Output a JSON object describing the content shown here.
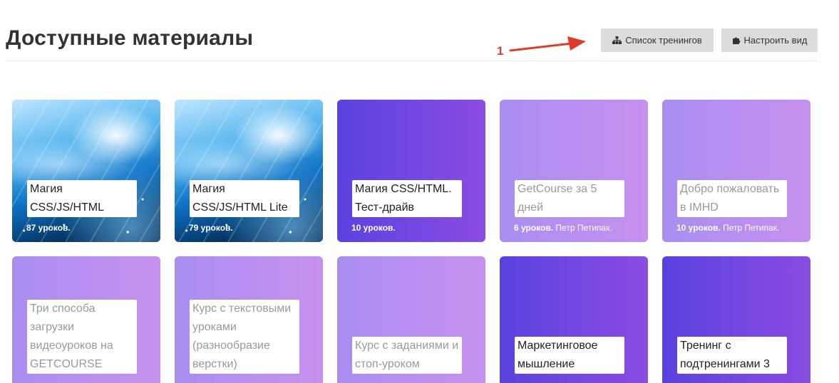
{
  "page": {
    "title": "Доступные материалы"
  },
  "toolbar": {
    "list_button": "Список тренингов",
    "view_button": "Настроить вид"
  },
  "annotation": {
    "number": "1",
    "arrow_color": "#e03c2b"
  },
  "colors": {
    "dark_gradient": [
      "#5a42e0",
      "#8b4ce3"
    ],
    "light_gradient": [
      "#a98ef0",
      "#c690ef"
    ],
    "button_bg": "#dcdcdc"
  },
  "cards": [
    {
      "title": "Магия CSS/JS/HTML",
      "lessons": "87 уроков.",
      "author": "",
      "style": "photo"
    },
    {
      "title": "Магия CSS/JS/HTML Lite",
      "lessons": "79 уроков.",
      "author": "",
      "style": "photo"
    },
    {
      "title": "Магия CSS/HTML. Тест-драйв",
      "lessons": "10 уроков.",
      "author": "",
      "style": "dark"
    },
    {
      "title": "GetCourse за 5 дней",
      "lessons": "6 уроков.",
      "author": "Петр Петипак.",
      "style": "light"
    },
    {
      "title": "Добро пожаловать в IMHD",
      "lessons": "10 уроков.",
      "author": "Петр Петипак.",
      "style": "light"
    },
    {
      "title": "Три способа загрузки видеоуроков на GETCOURSE",
      "lessons": "",
      "author": "",
      "style": "light"
    },
    {
      "title": "Курс с текстовыми уроками (разнообразие верстки)",
      "lessons": "",
      "author": "",
      "style": "light"
    },
    {
      "title": "Курс с заданиями и стоп-уроком",
      "lessons": "",
      "author": "",
      "style": "light"
    },
    {
      "title": "Маркетинговое мышление",
      "lessons": "",
      "author": "",
      "style": "dark"
    },
    {
      "title": "Тренинг с подтренингами 3",
      "lessons": "",
      "author": "",
      "style": "dark"
    }
  ]
}
